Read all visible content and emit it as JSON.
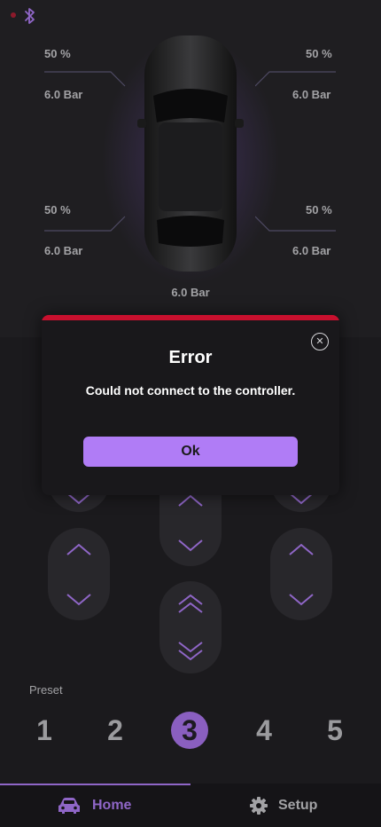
{
  "status": {
    "bluetooth_icon": "bluetooth-icon",
    "connection_dot_color": "#8c1a2b"
  },
  "tires": {
    "front_left": {
      "percent": "50 %",
      "pressure": "6.0 Bar"
    },
    "front_right": {
      "percent": "50 %",
      "pressure": "6.0 Bar"
    },
    "rear_left": {
      "percent": "50 %",
      "pressure": "6.0 Bar"
    },
    "rear_right": {
      "percent": "50 %",
      "pressure": "6.0 Bar"
    },
    "center_pressure": "6.0 Bar"
  },
  "modal": {
    "title": "Error",
    "message": "Could not connect to the controller.",
    "ok_label": "Ok",
    "accent_color": "#c8102e",
    "button_color": "#b07cf6"
  },
  "presets": {
    "title": "Preset",
    "items": [
      "1",
      "2",
      "3",
      "4",
      "5"
    ],
    "selected": "3",
    "accent_color": "#8a5fc0"
  },
  "nav": {
    "home_label": "Home",
    "setup_label": "Setup",
    "active": "Home"
  }
}
